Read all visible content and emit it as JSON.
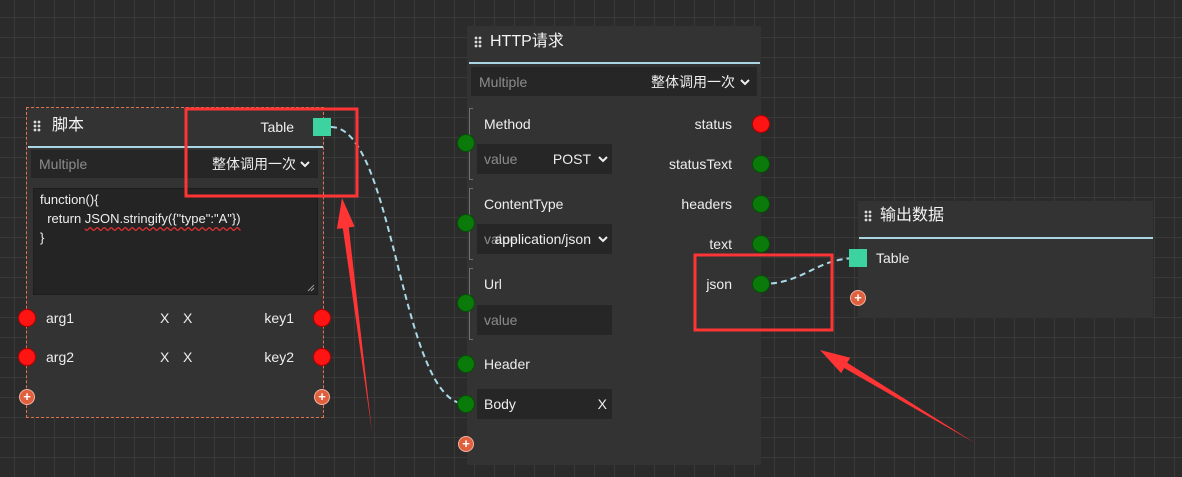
{
  "colors": {
    "canvas": "#2b2b2b",
    "grid": "#393939",
    "node_bg": "#333333",
    "field_bg": "#262626",
    "text": "#eeeeee",
    "placeholder": "#8c8c8c",
    "port_red": "#ff1414",
    "port_green": "#0a7a0a",
    "port_teal": "#3dd3a0",
    "link": "#a9d9e6",
    "header_underline": "#aad5e3",
    "add_button": "#e0603e",
    "selected_border": "#e0734f",
    "annotation": "#ff3535"
  },
  "icons": {
    "drag": "drag-handle-icon",
    "dropdown": "chevron-down-icon",
    "resize": "resize-grip-icon"
  },
  "script_node": {
    "title": "脚本",
    "selected": true,
    "output": {
      "label": "Table"
    },
    "mode": {
      "placeholder": "Multiple",
      "value": "整体调用一次"
    },
    "code": {
      "line1": "function(){",
      "line2_indent": "  return ",
      "line2_call": "JSON.stringify({\"type\":\"A\"})",
      "line3": "}"
    },
    "args": [
      {
        "name": "arg1",
        "remove_input": "X",
        "remove_output": "X",
        "key": "key1"
      },
      {
        "name": "arg2",
        "remove_input": "X",
        "remove_output": "X",
        "key": "key2"
      }
    ],
    "add_input": "+",
    "add_output": "+"
  },
  "http_node": {
    "title": "HTTP请求",
    "mode": {
      "placeholder": "Multiple",
      "value": "整体调用一次"
    },
    "inputs": {
      "method": {
        "label": "Method",
        "placeholder": "value",
        "selected": "POST"
      },
      "content_type": {
        "label": "ContentType",
        "placeholder": "value",
        "selected": "application/json"
      },
      "url": {
        "label": "Url",
        "placeholder": "value"
      },
      "header": {
        "label": "Header"
      },
      "body": {
        "label": "Body",
        "remove": "X"
      }
    },
    "outputs": [
      {
        "label": "status"
      },
      {
        "label": "statusText"
      },
      {
        "label": "headers"
      },
      {
        "label": "text"
      },
      {
        "label": "json"
      }
    ],
    "add_input": "+"
  },
  "output_node": {
    "title": "输出数据",
    "input": {
      "label": "Table"
    },
    "add_input": "+"
  }
}
